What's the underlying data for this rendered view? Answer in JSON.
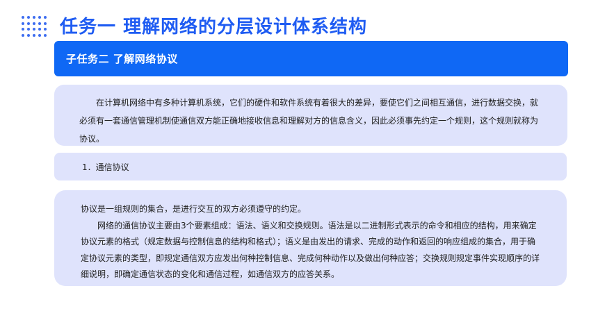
{
  "header": {
    "title": "任务一  理解网络的分层设计体系结构"
  },
  "subtask": {
    "title": "子任务二  了解网络协议"
  },
  "intro": {
    "text": "在计算机网络中有多种计算机系统，它们的硬件和软件系统有着很大的差异，要使它们之间相互通信，进行数据交换，就必须有一套通信管理机制使通信双方能正确地接收信息和理解对方的信息含义，因此必须事先约定一个规则，这个规则就称为协议。"
  },
  "section": {
    "heading": "1．通信协议",
    "definition": "协议是一组规则的集合，是进行交互的双方必须遵守的约定。",
    "detail": "网络的通信协议主要由3个要素组成：语法、语义和交换规则。语法是以二进制形式表示的命令和相应的结构，用来确定协议元素的格式（规定数据与控制信息的结构和格式）；语义是由发出的请求、完成的动作和返回的响应组成的集合，用于确定协议元素的类型，即规定通信双方应发出何种控制信息、完成何种动作以及做出何种应答；交换规则规定事件实现顺序的详细说明，即确定通信状态的变化和通信过程，如通信双方的应答关系。"
  },
  "colors": {
    "accent": "#1f5cf2",
    "bar": "#0f68f5",
    "card": "#dfe3fc"
  }
}
